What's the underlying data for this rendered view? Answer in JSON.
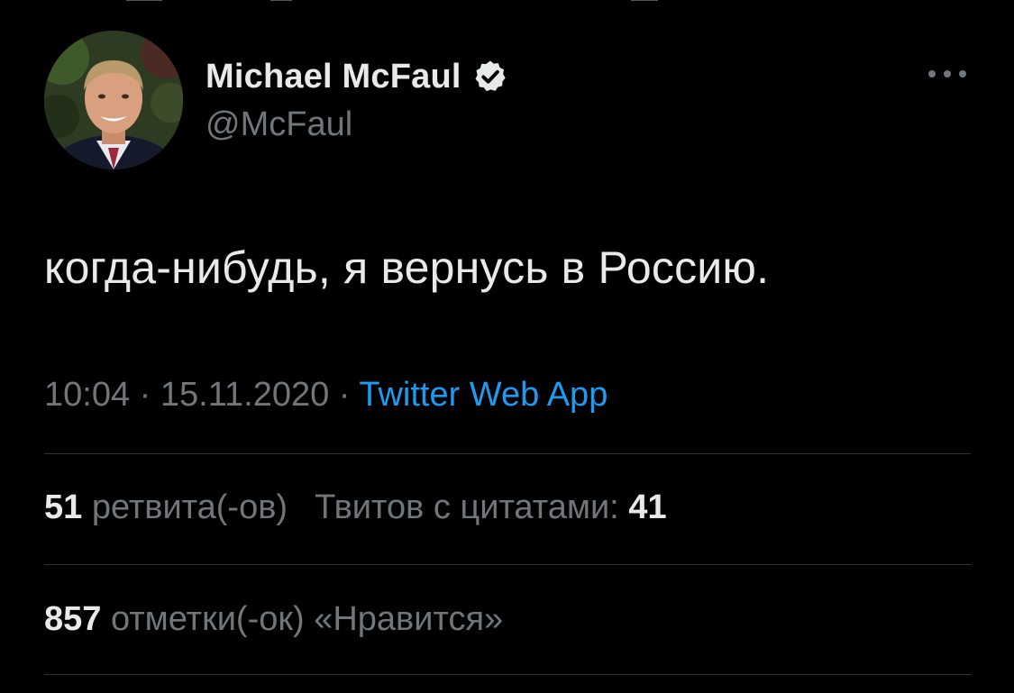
{
  "tweet": {
    "author": {
      "display_name": "Michael McFaul",
      "handle": "@McFaul",
      "verified": true,
      "avatar_icon": "profile-photo"
    },
    "more_icon": "more-horizontal-icon",
    "text": "когда-нибудь, я вернусь в Россию.",
    "time": "10:04",
    "date": "15.11.2020",
    "separator": " · ",
    "source": "Twitter Web App"
  },
  "stats": {
    "retweets_count": "51",
    "retweets_label": "ретвита(-ов)",
    "quotes_label": "Твитов с цитатами:",
    "quotes_count": "41",
    "likes_count": "857",
    "likes_label": "отметки(-ок) «Нравится»"
  },
  "colors": {
    "background": "#000000",
    "primary_text": "#e7e9ea",
    "secondary_text": "#71767b",
    "accent": "#1d9bf0",
    "divider": "#2f3336"
  }
}
